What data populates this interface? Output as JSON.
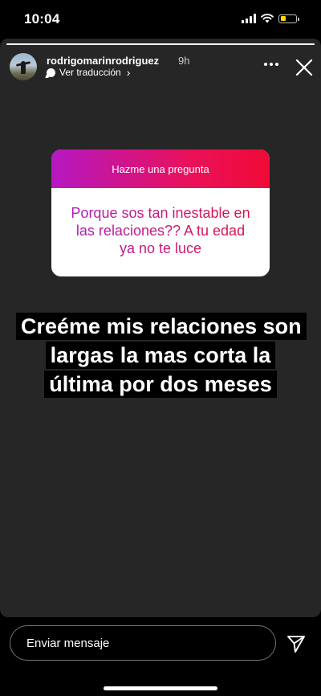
{
  "status_bar": {
    "time": "10:04",
    "battery_level": 0.4,
    "battery_color": "#ffd60a"
  },
  "story": {
    "progress": 1.0,
    "author": {
      "username": "rodrigomarinrodriguez",
      "time_ago": "9h",
      "avatar_icon": "profile-photo"
    },
    "translation_link": "Ver traducción",
    "question_sticker": {
      "header": "Hazme una pregunta",
      "question": "Porque sos tan inestable en las relaciones?? A tu edad ya no te luce",
      "gradient_start": "#b518c2",
      "gradient_end": "#f00a36"
    },
    "answer_text": "Creéme mis relaciones son largas la mas corta la última por dos meses"
  },
  "message_bar": {
    "placeholder": "Enviar mensaje",
    "send_icon": "paper-plane-icon"
  }
}
